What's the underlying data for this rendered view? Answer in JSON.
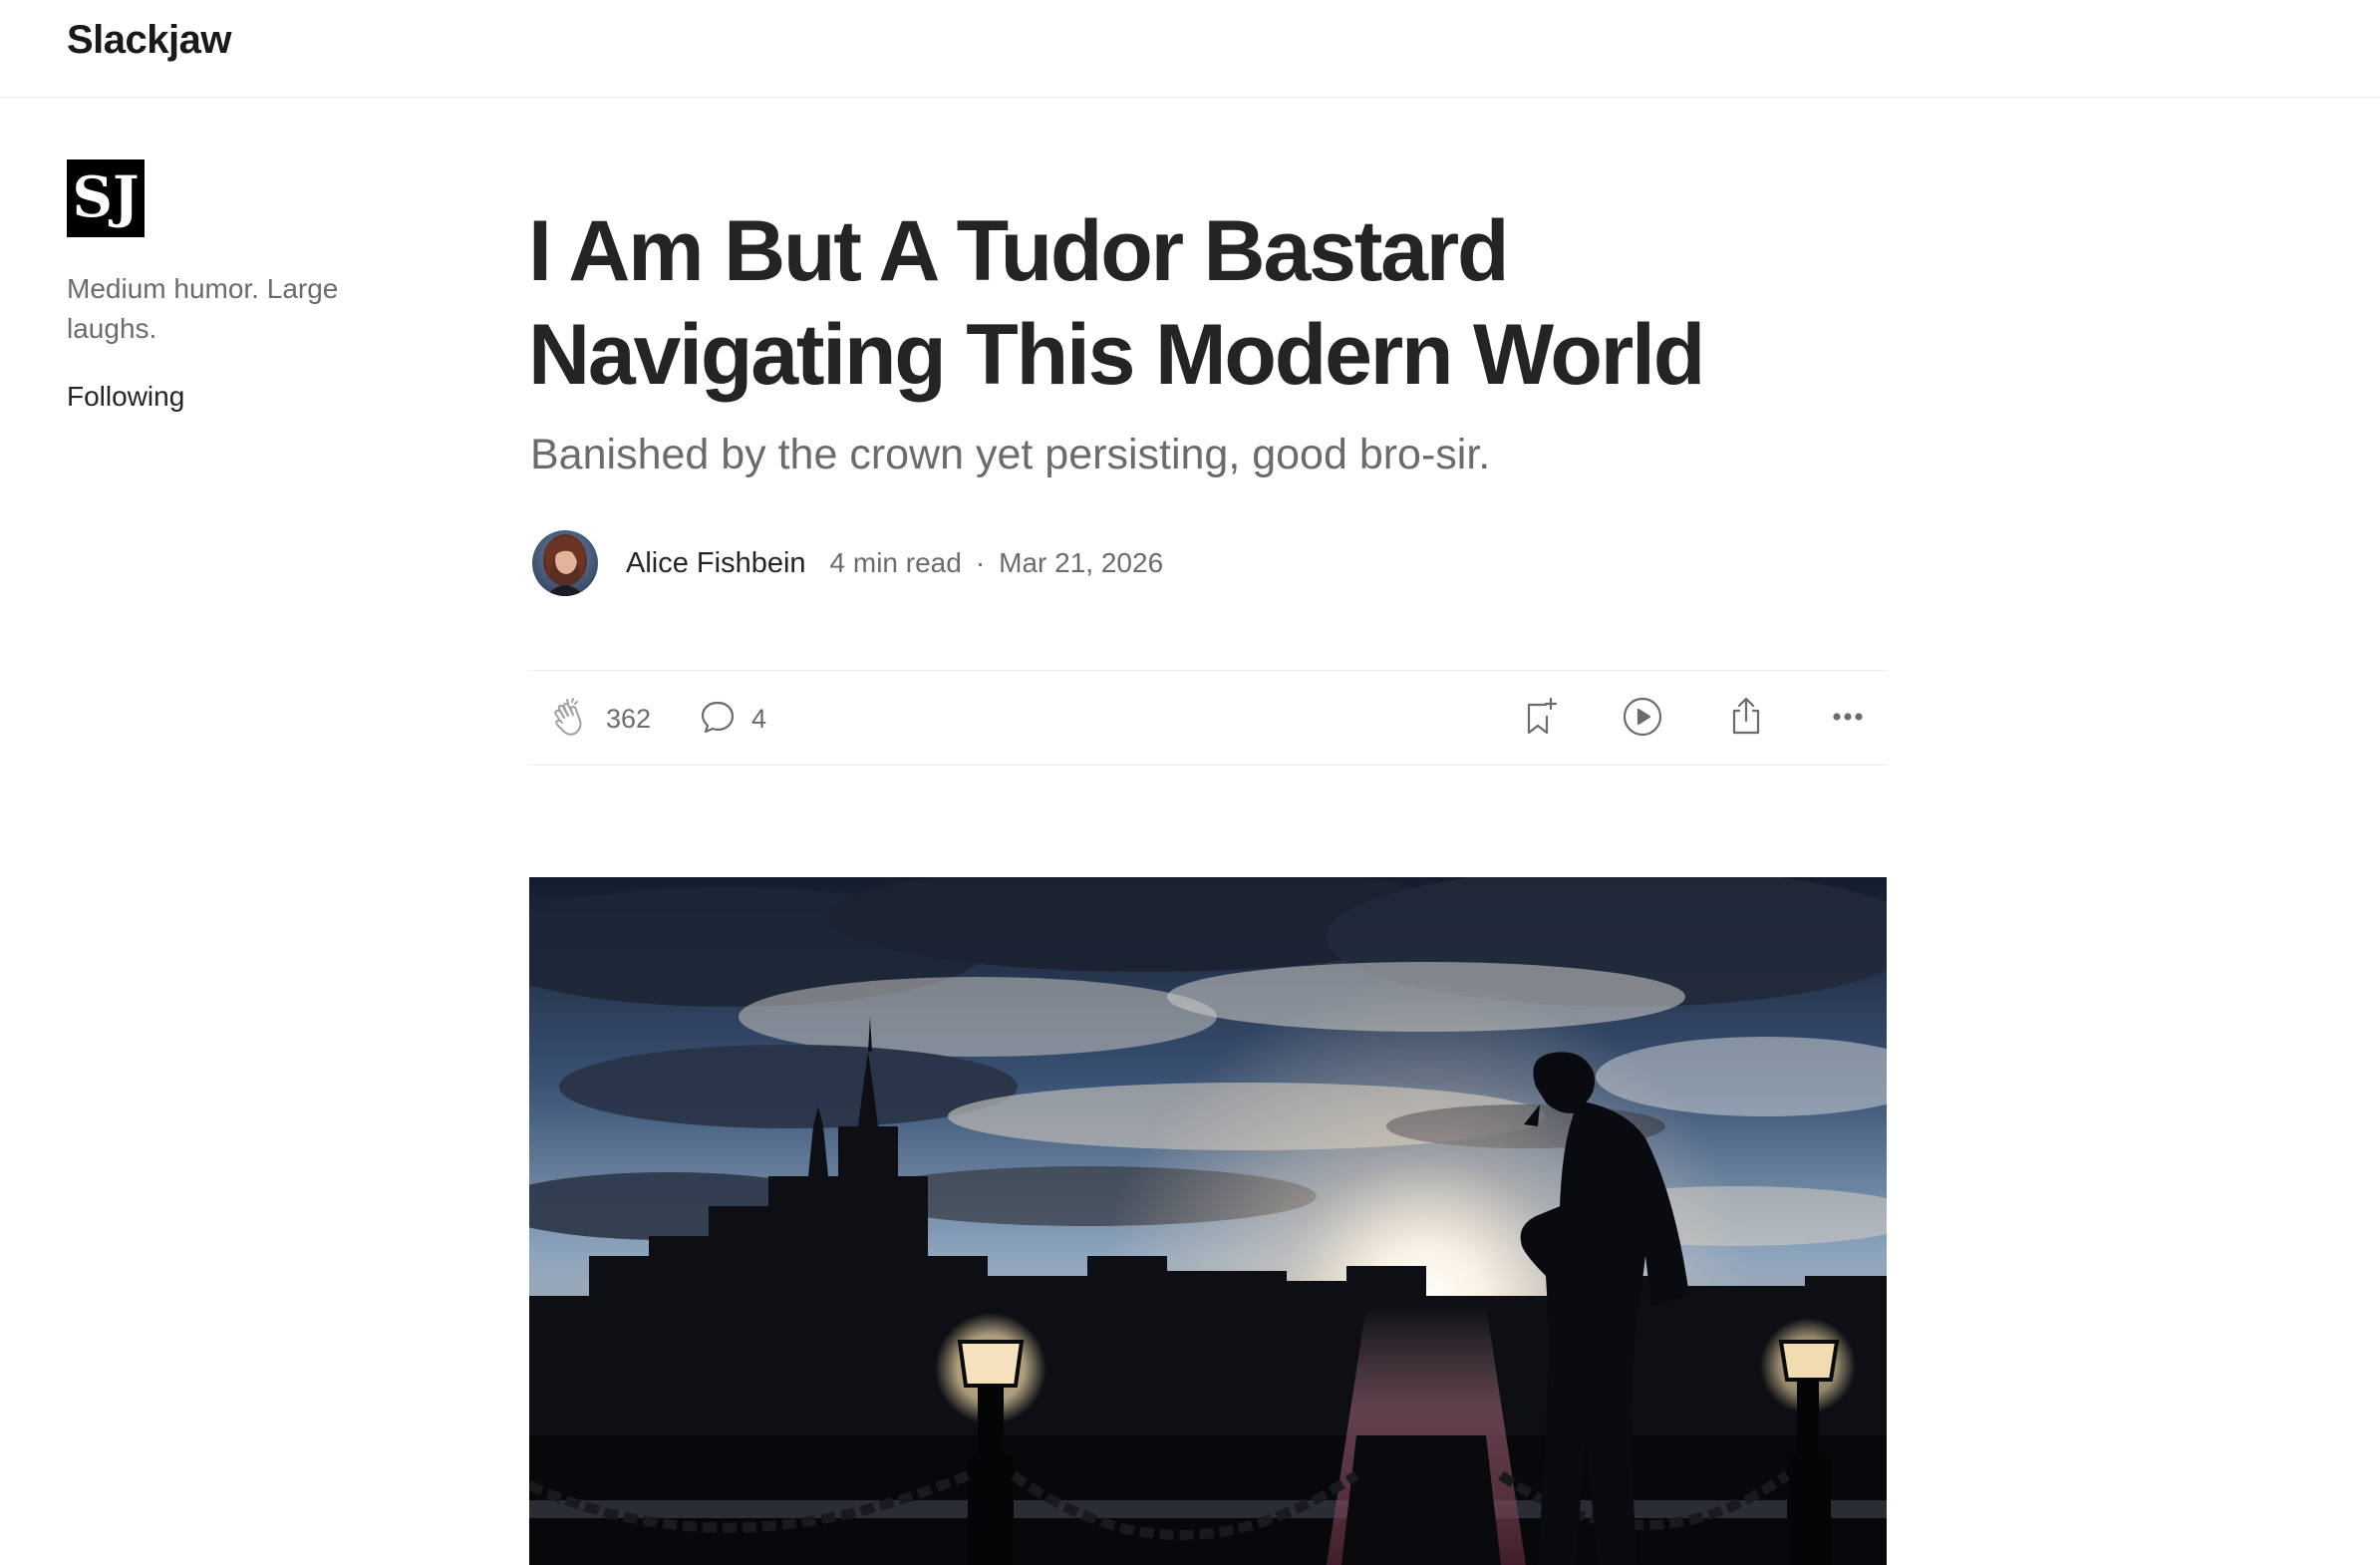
{
  "header": {
    "brand": "Slackjaw"
  },
  "sidebar": {
    "logo_text": "SJ",
    "tagline": "Medium humor. Large laughs.",
    "follow_label": "Following"
  },
  "article": {
    "title": "I Am But A Tudor Bastard Navigating This Modern World",
    "subtitle": "Banished by the crown yet persisting, good bro-sir.",
    "author": "Alice Fishbein",
    "read_time": "4 min read",
    "separator": "·",
    "date": "Mar 21, 2026"
  },
  "actions": {
    "claps": "362",
    "responses": "4",
    "icons": [
      "clap-icon",
      "response-icon",
      "bookmark-add-icon",
      "listen-icon",
      "share-icon",
      "more-icon"
    ]
  },
  "colors": {
    "text_primary": "#242424",
    "text_secondary": "#6b6b6b",
    "divider": "#ececec"
  }
}
